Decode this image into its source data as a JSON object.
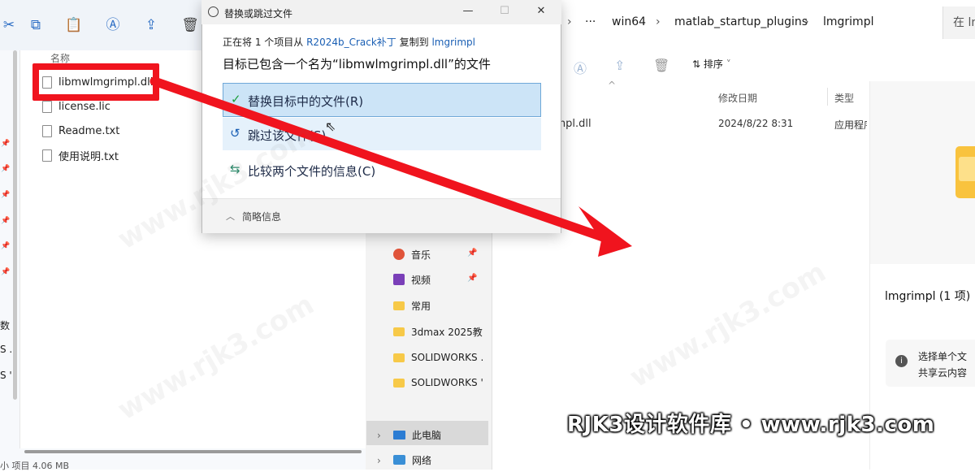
{
  "left_window": {
    "column_name": "名称",
    "files": [
      {
        "name": "libmwlmgrimpl.dll",
        "icon": "dll-file-icon"
      },
      {
        "name": "license.lic",
        "icon": "file-icon"
      },
      {
        "name": "Readme.txt",
        "icon": "text-file-icon"
      },
      {
        "name": "使用说明.txt",
        "icon": "text-file-icon"
      }
    ],
    "side_labels": [
      "数",
      "S .",
      "S '"
    ],
    "status_text": "小 项目 4.06 MB"
  },
  "dialog": {
    "title": "替换或跳过文件",
    "line1_prefix": "正在将 1 个项目从 ",
    "line1_source": "R2024b_Crack补丁",
    "line1_mid": " 复制到 ",
    "line1_dest": "lmgrimpl",
    "line2": "目标已包含一个名为“libmwlmgrimpl.dll”的文件",
    "option_replace": "替换目标中的文件(R)",
    "option_skip": "跳过该文件(S)",
    "option_compare": "比较两个文件的信息(C)",
    "details_toggle": "简略信息",
    "window_buttons": {
      "minimize": "—",
      "maximize": "☐",
      "close": "✕"
    }
  },
  "right_window": {
    "breadcrumbs": [
      "win64",
      "matlab_startup_plugins",
      "lmgrimpl"
    ],
    "breadcrumb_more": "···",
    "search_placeholder": "在 lm",
    "sort_label": "排序",
    "columns": {
      "date": "修改日期",
      "type": "类型"
    },
    "file": {
      "name": "lmgrimpl.dll",
      "date": "2024/8/22 8:31",
      "type": "应用程序"
    },
    "details_title": "lmgrimpl (1 项)",
    "info_line1": "选择单个文",
    "info_line2": "共享云内容"
  },
  "nav_pane": {
    "items": [
      {
        "label": "音乐",
        "icon": "music-icon",
        "pinned": true
      },
      {
        "label": "视频",
        "icon": "video-icon",
        "pinned": true
      },
      {
        "label": "常用",
        "icon": "folder-icon",
        "pinned": false
      },
      {
        "label": "3dmax 2025教",
        "icon": "folder-icon",
        "pinned": false
      },
      {
        "label": "SOLIDWORKS .",
        "icon": "folder-icon",
        "pinned": false
      },
      {
        "label": "SOLIDWORKS '",
        "icon": "folder-icon",
        "pinned": false
      },
      {
        "label": "此电脑",
        "icon": "computer-icon",
        "pinned": false
      },
      {
        "label": "网络",
        "icon": "network-icon",
        "pinned": false
      }
    ]
  },
  "watermark": "RJK3设计软件库 • www.rjk3.com",
  "colors": {
    "highlight": "#f0141e",
    "accent": "#1a5fb4",
    "selection": "#cce4f7"
  }
}
